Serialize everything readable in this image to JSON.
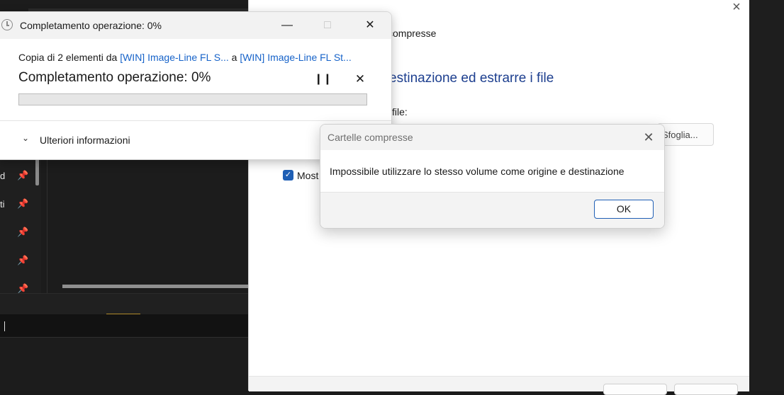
{
  "extract_wizard": {
    "title_fragment": "compresse",
    "heading_fragment": "estinazione ed estrarre i file",
    "label_fragment": "file:",
    "browse_fragment": "Sfoglia...",
    "checkbox_fragment": "Most",
    "checkbox_checked": true,
    "close_glyph": "×"
  },
  "explorer": {
    "pinned_fragments": [
      "d",
      "ti",
      "",
      "",
      ""
    ]
  },
  "copy_dialog": {
    "window_title": "Completamento operazione: 0%",
    "copy_prefix": "Copia di 2 elementi da ",
    "source_link": "[WIN] Image-Line FL S...",
    "copy_mid": " a ",
    "dest_link": "[WIN] Image-Line FL St...",
    "progress_title": "Completamento operazione: 0%",
    "progress": 0,
    "more_info_label": "Ulteriori informazioni",
    "accent": "#1763c9"
  },
  "error_box": {
    "title": "Cartelle compresse",
    "message": "Impossibile utilizzare lo stesso volume come origine e destinazione",
    "ok_label": "OK",
    "accent": "#1f5fb5"
  }
}
